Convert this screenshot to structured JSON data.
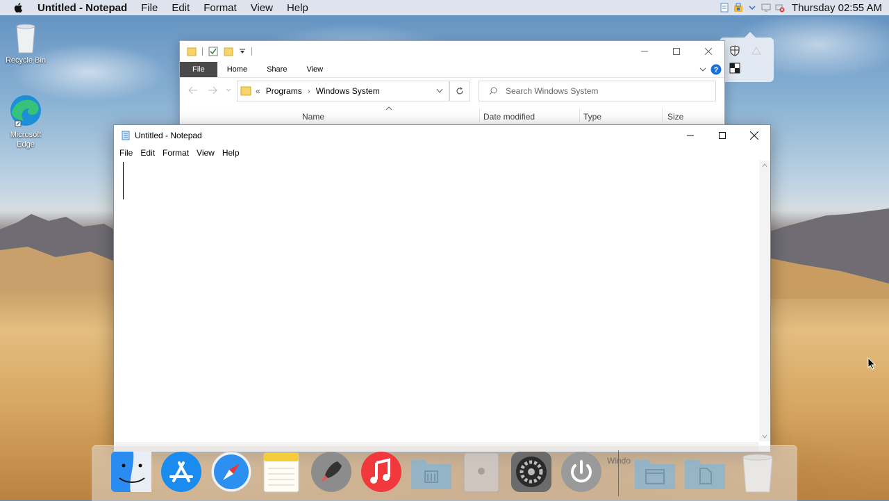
{
  "menubar": {
    "app_name": "Untitled - Notepad",
    "items": [
      "File",
      "Edit",
      "Format",
      "View",
      "Help"
    ],
    "clock": "Thursday 02:55 AM"
  },
  "desktop": {
    "icons": [
      {
        "label": "Recycle Bin"
      },
      {
        "label": "Microsoft Edge"
      }
    ]
  },
  "explorer": {
    "tabs": [
      "File",
      "Home",
      "Share",
      "View"
    ],
    "breadcrumb": {
      "prefix": "«",
      "items": [
        "Programs",
        "Windows System"
      ]
    },
    "search_placeholder": "Search Windows System",
    "columns": [
      "Name",
      "Date modified",
      "Type",
      "Size"
    ]
  },
  "notepad": {
    "title": "Untitled - Notepad",
    "menu": [
      "File",
      "Edit",
      "Format",
      "View",
      "Help"
    ],
    "content": ""
  },
  "dock": {
    "items": [
      "finder-icon",
      "app-store-icon",
      "safari-icon",
      "notes-icon",
      "launchpad-icon",
      "music-icon",
      "applications-folder-icon",
      "mac-pro-icon",
      "system-preferences-icon",
      "power-icon",
      "window-folder-icon",
      "documents-folder-icon",
      "trash-icon"
    ],
    "faded_label": "Windo"
  },
  "colors": {
    "explorer_file_tab": "#4a4a4a",
    "music_red": "#f0383d",
    "appstore_blue": "#1a8cf0",
    "help_blue": "#1b6fd6"
  }
}
